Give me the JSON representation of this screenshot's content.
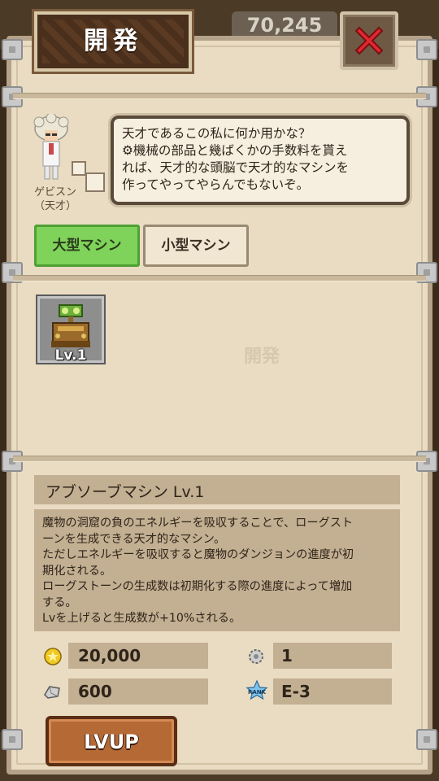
{
  "background": {
    "score": "70,245"
  },
  "title": "開発",
  "npc": {
    "name_line1": "ゲビスン",
    "name_line2": "（天才）"
  },
  "speech": {
    "line1": "天才であるこの私に何か用かな？",
    "line2": "⚙機械の部品と幾ばくかの手数料を貰え",
    "line3": "れば、天才的な頭脳で天才的なマシンを",
    "line4": "作ってやってやらんでもないぞ。"
  },
  "tabs": [
    {
      "label": "大型マシン",
      "active": true
    },
    {
      "label": "小型マシン",
      "active": false
    }
  ],
  "machine_slot": {
    "level": "Lv.1"
  },
  "watermark": "開発",
  "info": {
    "name": "アブソーブマシン Lv.1",
    "desc_lines": [
      "魔物の洞窟の負のエネルギーを吸収することで、ローグスト",
      "ーンを生成できる天才的なマシン。",
      "ただしエネルギーを吸収すると魔物のダンジョンの進度が初",
      "期化される。",
      "ローグストーンの生成数は初期化する際の進度によって増加",
      "する。",
      "Lvを上げると生成数が+10%される。"
    ]
  },
  "stats": {
    "gold": "20,000",
    "gear": "1",
    "stone": "600",
    "rank_label": "RANK",
    "rank": "E-3"
  },
  "lvup_label": "LVUP",
  "colors": {
    "panel": "#e9dcc2",
    "tab_active": "#7fd25a",
    "close": "#e0282e",
    "lvup": "#b56a36"
  }
}
